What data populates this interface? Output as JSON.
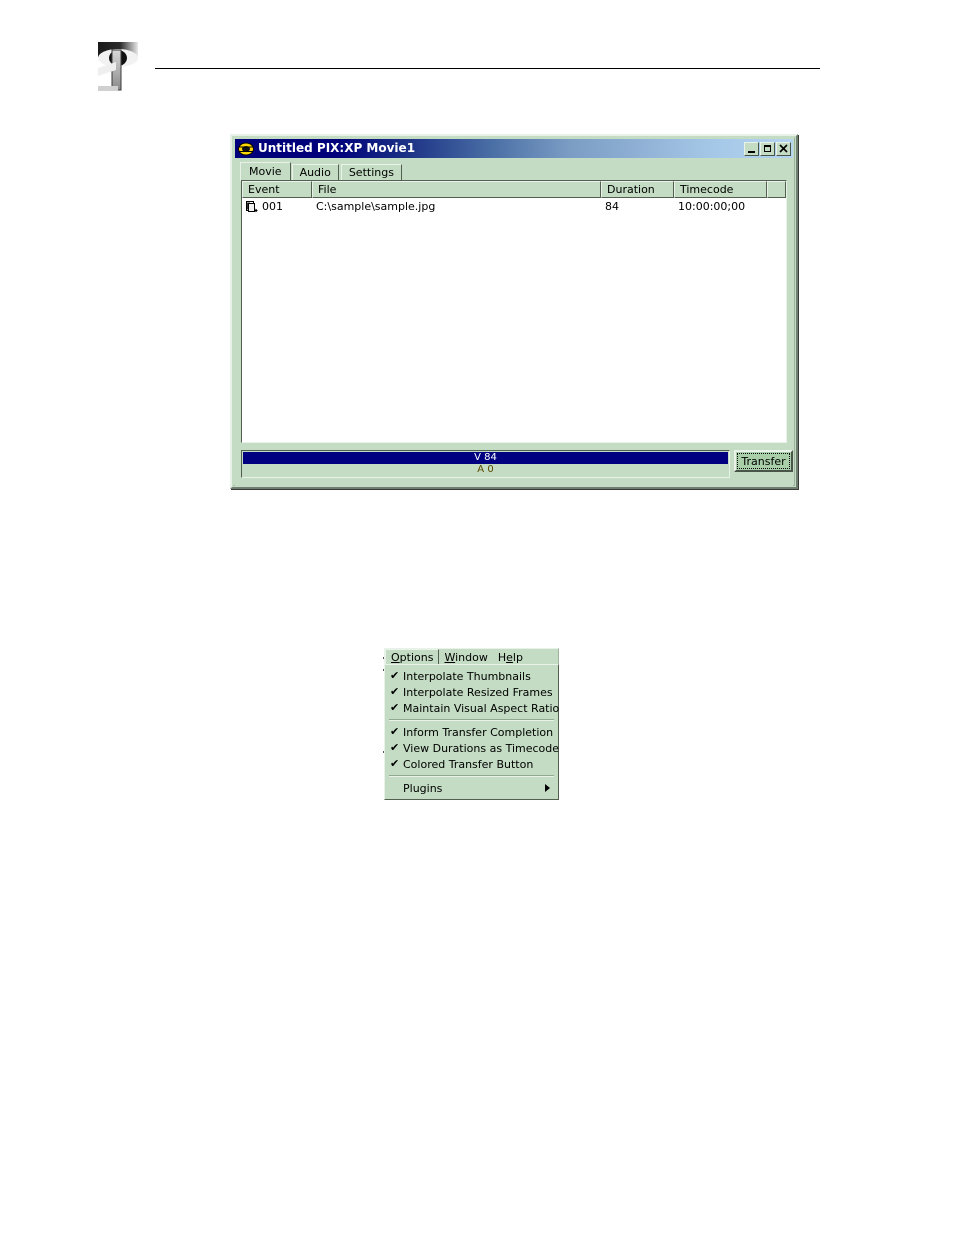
{
  "page": {
    "logo_name": "grass-valley-logo"
  },
  "app_window": {
    "title": "Untitled PIX:XP Movie1",
    "icon": "disc-icon",
    "title_buttons": [
      {
        "name": "minimize-button",
        "label": "_"
      },
      {
        "name": "maximize-button",
        "label": "□"
      },
      {
        "name": "close-button",
        "label": "×"
      }
    ],
    "tabs": [
      {
        "label": "Movie",
        "active": true
      },
      {
        "label": "Audio",
        "active": false
      },
      {
        "label": "Settings",
        "active": false
      }
    ],
    "list": {
      "columns": [
        "Event",
        "File",
        "Duration",
        "Timecode",
        ""
      ],
      "rows": [
        {
          "icon": "clip-icon",
          "event": "001",
          "file": "C:\\sample\\sample.jpg",
          "duration": "84",
          "timecode": "10:00:00;00"
        }
      ]
    },
    "meter": {
      "video_label": "V 84",
      "audio_label": "A 0",
      "video_color": "#000080",
      "audio_color": "#c3dcc3"
    },
    "transfer_button_label": "Transfer"
  },
  "options_menu": {
    "menu_bar": [
      {
        "label": "Options",
        "accel": "O",
        "open": true
      },
      {
        "label": "Window",
        "accel": "W",
        "open": false
      },
      {
        "label": "Help",
        "accel": "e",
        "open": false
      }
    ],
    "groups": [
      {
        "items": [
          {
            "label": "Interpolate Thumbnails",
            "checked": true
          },
          {
            "label": "Interpolate Resized Frames",
            "checked": true
          },
          {
            "label": "Maintain Visual Aspect Ratio",
            "checked": true
          }
        ]
      },
      {
        "items": [
          {
            "label": "Inform Transfer Completion",
            "checked": true
          },
          {
            "label": "View Durations as Timecode",
            "checked": true
          },
          {
            "label": "Colored Transfer Button",
            "checked": true
          }
        ]
      },
      {
        "items": [
          {
            "label": "Plugins",
            "checked": false,
            "submenu": true
          }
        ]
      }
    ],
    "check_glyph": "✔",
    "submenu_arrow": "▶"
  }
}
